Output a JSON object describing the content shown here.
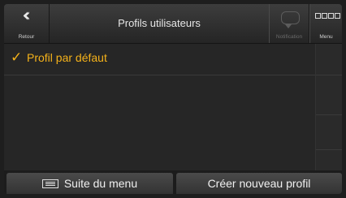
{
  "header": {
    "back_label": "Retour",
    "title": "Profils utilisateurs",
    "notification_label": "Notification",
    "menu_label": "Menu"
  },
  "profiles": [
    {
      "label": "Profil par défaut",
      "selected": true
    }
  ],
  "footer": {
    "more_menu_label": "Suite du menu",
    "create_profile_label": "Créer nouveau profil"
  },
  "colors": {
    "accent": "#f5b21a",
    "background": "#262626",
    "header": "#333333"
  },
  "icons": [
    "back-chevron-icon",
    "speech-bubble-icon",
    "menu-squares-icon",
    "checkmark-icon",
    "list-menu-icon"
  ]
}
